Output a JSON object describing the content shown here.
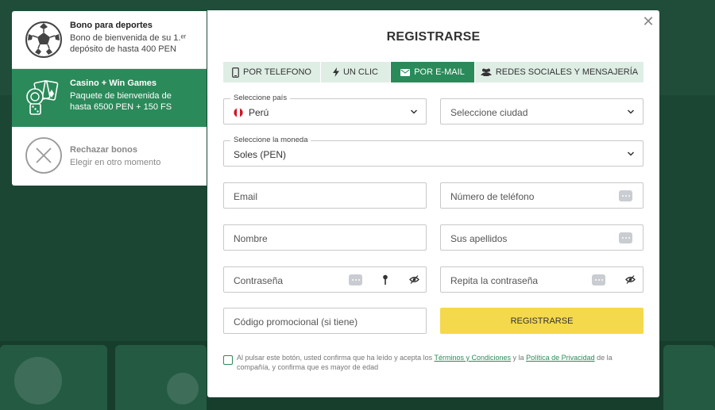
{
  "bonus": {
    "items": [
      {
        "title": "Bono para deportes",
        "desc1": "Bono de bienvenida de su 1.ᵉʳ",
        "desc2": "depósito de hasta 400 PEN"
      },
      {
        "title": "Casino + Win Games",
        "desc1": "Paquete de bienvenida de",
        "desc2": "hasta 6500 PEN + 150 FS"
      },
      {
        "title": "Rechazar bonos",
        "desc1": "Elegir en otro momento"
      }
    ]
  },
  "modal": {
    "title": "REGISTRARSE",
    "close": "✕",
    "tabs": [
      {
        "label": "POR TELEFONO",
        "icon": "phone-icon"
      },
      {
        "label": "UN CLIC",
        "icon": "lightning-icon"
      },
      {
        "label": "POR E-MAIL",
        "icon": "envelope-icon"
      },
      {
        "label": "REDES SOCIALES Y MENSAJERÍA",
        "icon": "people-icon"
      }
    ],
    "country": {
      "label": "Seleccione país",
      "value": "Perú"
    },
    "city": {
      "placeholder": "Seleccione ciudad"
    },
    "currency": {
      "label": "Seleccione la moneda",
      "value": "Soles (PEN)"
    },
    "email": {
      "placeholder": "Email"
    },
    "phone": {
      "placeholder": "Número de teléfono"
    },
    "first_name": {
      "placeholder": "Nombre"
    },
    "last_name": {
      "placeholder": "Sus apellidos"
    },
    "password": {
      "placeholder": "Contraseña"
    },
    "password_repeat": {
      "placeholder": "Repita la contraseña"
    },
    "promo": {
      "placeholder": "Código promocional (si tiene)"
    },
    "submit": "REGISTRARSE",
    "consent": {
      "text1": "Al pulsar este botón, usted confirma que ha leído y acepta los ",
      "terms": "Términos y Condiciones",
      "text2": " y la ",
      "privacy": "Política de Privacidad",
      "text3": " de la compañía, y confirma que es mayor de edad"
    }
  },
  "colors": {
    "accent": "#2b8a5a",
    "button": "#f5d94c",
    "tab_bg": "#dfeee5",
    "page_bg": "#1d4a36"
  }
}
